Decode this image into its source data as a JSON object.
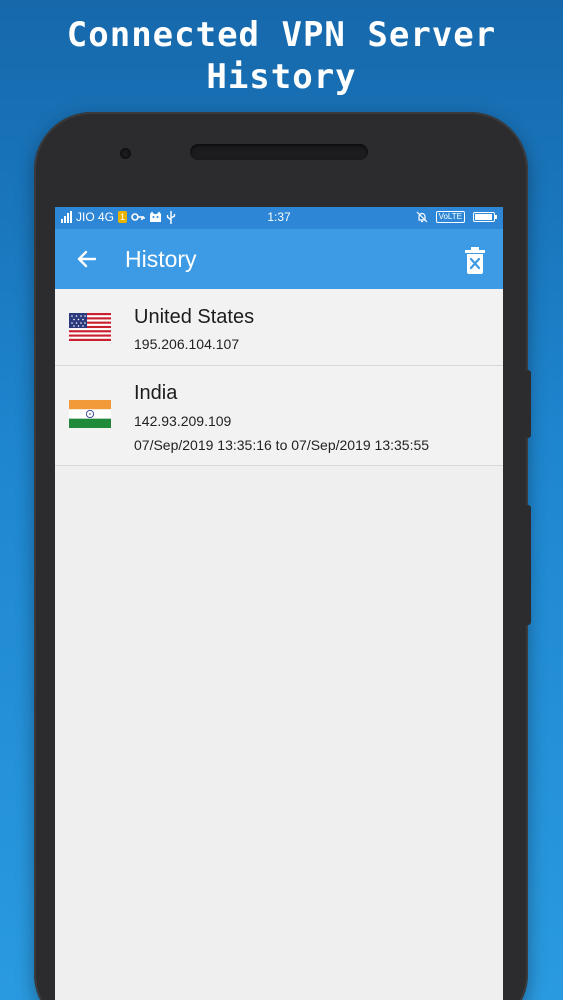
{
  "promo": {
    "title_line1": "Connected VPN Server",
    "title_line2": "History"
  },
  "status_bar": {
    "carrier": "JIO 4G",
    "sim_badge": "1",
    "time": "1:37",
    "volte": "VoLTE",
    "battery_level": 0.95
  },
  "app_bar": {
    "title": "History",
    "back_icon": "arrow-left-icon",
    "delete_icon": "delete-icon"
  },
  "history": [
    {
      "country": "United States",
      "flag": "us-flag-icon",
      "ip": "195.206.104.107",
      "time_range": ""
    },
    {
      "country": "India",
      "flag": "india-flag-icon",
      "ip": "142.93.209.109",
      "time_range": "07/Sep/2019 13:35:16 to 07/Sep/2019 13:35:55"
    }
  ],
  "colors": {
    "app_bar": "#3d9be6",
    "status_bar": "#2e86d6",
    "background_top": "#1668ab",
    "background_bottom": "#2a9ae0"
  }
}
